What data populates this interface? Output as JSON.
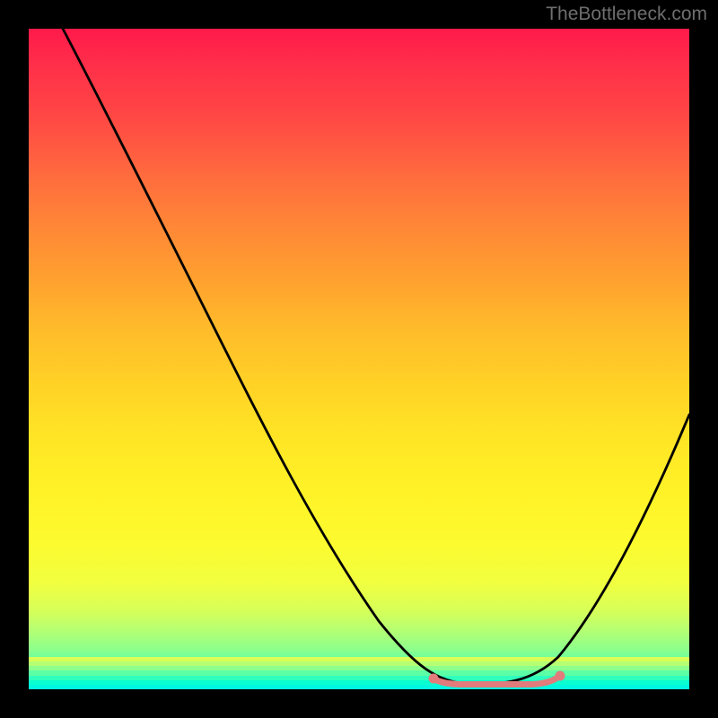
{
  "watermark": "TheBottleneck.com",
  "chart_data": {
    "type": "line",
    "title": "",
    "xlabel": "",
    "ylabel": "",
    "ylim": [
      0,
      100
    ],
    "series": [
      {
        "name": "curve",
        "x": [
          0.0,
          0.05,
          0.1,
          0.15,
          0.2,
          0.25,
          0.3,
          0.35,
          0.4,
          0.45,
          0.5,
          0.55,
          0.6,
          0.65,
          0.7,
          0.75,
          0.8,
          0.85,
          0.9,
          0.95,
          1.0
        ],
        "values": [
          100,
          92,
          84,
          76,
          68,
          60,
          52,
          44,
          36,
          27,
          18,
          10,
          4,
          1,
          0,
          0,
          2,
          10,
          22,
          36,
          50
        ]
      },
      {
        "name": "flat-segment",
        "x": [
          0.62,
          0.64,
          0.66,
          0.68,
          0.7,
          0.72,
          0.74,
          0.76,
          0.78,
          0.8
        ],
        "values": [
          0.8,
          0.5,
          0.3,
          0.2,
          0.2,
          0.2,
          0.3,
          0.5,
          0.8,
          1.2
        ],
        "color": "#e27b7b"
      }
    ]
  }
}
